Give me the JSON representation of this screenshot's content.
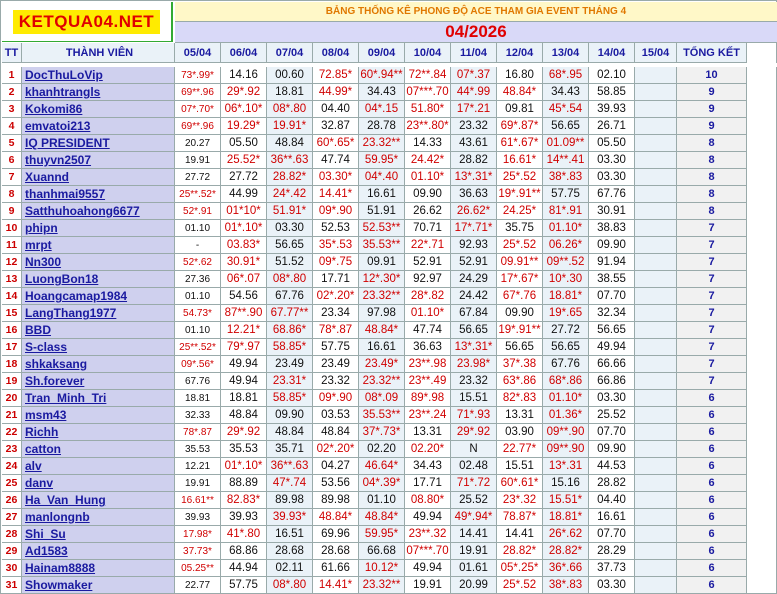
{
  "logo_text": "KETQUA04.NET",
  "title": "BẢNG THỐNG KÊ PHONG ĐỘ ACE THAM GIA EVENT THÁNG 4",
  "month": "04/2026",
  "headers": {
    "tt": "TT",
    "member": "THÀNH VIÊN",
    "dates": [
      "05/04",
      "06/04",
      "07/04",
      "08/04",
      "09/04",
      "10/04",
      "11/04",
      "12/04",
      "13/04",
      "14/04",
      "15/04"
    ],
    "total": "TỔNG KẾT"
  },
  "rows": [
    {
      "tt": "1",
      "name": "DocThuLoVip",
      "cells": [
        "73*.99*",
        "14.16",
        "00.60",
        "72.85*",
        "60*.94**",
        "72**.84",
        "07*.37",
        "16.80",
        "68*.95",
        "02.10",
        ""
      ],
      "total": "10"
    },
    {
      "tt": "2",
      "name": "khanhtrangls",
      "cells": [
        "69**.96",
        "29*.92",
        "18.81",
        "44.99*",
        "34.43",
        "07***.70",
        "44*.99",
        "48.84*",
        "34.43",
        "58.85",
        ""
      ],
      "total": "9"
    },
    {
      "tt": "3",
      "name": "Kokomi86",
      "cells": [
        "07*.70*",
        "06*.10*",
        "08*.80",
        "04.40",
        "04*.15",
        "51.80*",
        "17*.21",
        "09.81",
        "45*.54",
        "39.93",
        ""
      ],
      "total": "9"
    },
    {
      "tt": "4",
      "name": "emvatoi213",
      "cells": [
        "69**.96",
        "19.29*",
        "19.91*",
        "32.87",
        "28.78",
        "23**.80*",
        "23.32",
        "69*.87*",
        "56.65",
        "26.71",
        ""
      ],
      "total": "9"
    },
    {
      "tt": "5",
      "name": "IQ PRESIDENT",
      "cells": [
        "20.27",
        "05.50",
        "48.84",
        "60*.65*",
        "23.32**",
        "14.33",
        "43.61",
        "61*.67*",
        "01.09**",
        "05.50",
        ""
      ],
      "total": "8"
    },
    {
      "tt": "6",
      "name": "thuyvn2507",
      "cells": [
        "19.91",
        "25.52*",
        "36**.63",
        "47.74",
        "59.95*",
        "24.42*",
        "28.82",
        "16.61*",
        "14**.41",
        "03.30",
        ""
      ],
      "total": "8"
    },
    {
      "tt": "7",
      "name": "Xuannd",
      "cells": [
        "27.72",
        "27.72",
        "28.82*",
        "03.30*",
        "04*.40",
        "01.10*",
        "13*.31*",
        "25*.52",
        "38*.83",
        "03.30",
        ""
      ],
      "total": "8"
    },
    {
      "tt": "8",
      "name": "thanhmai9557",
      "cells": [
        "25**.52*",
        "44.99",
        "24*.42",
        "14.41*",
        "16.61",
        "09.90",
        "36.63",
        "19*.91**",
        "57.75",
        "67.76",
        ""
      ],
      "total": "8"
    },
    {
      "tt": "9",
      "name": "Satthuhoahong6677",
      "cells": [
        "52*.91",
        "01*10*",
        "51.91*",
        "09*.90",
        "51.91",
        "26.62",
        "26.62*",
        "24.25*",
        "81*.91",
        "30.91",
        ""
      ],
      "total": "8"
    },
    {
      "tt": "10",
      "name": "phipn",
      "cells": [
        "01.10",
        "01*.10*",
        "03.30",
        "52.53",
        "52.53**",
        "70.71",
        "17*.71*",
        "35.75",
        "01.10*",
        "38.83",
        ""
      ],
      "total": "7"
    },
    {
      "tt": "11",
      "name": "mrpt",
      "cells": [
        "-",
        "03.83*",
        "56.65",
        "35*.53",
        "35.53**",
        "22*.71",
        "92.93",
        "25*.52",
        "06.26*",
        "09.90",
        ""
      ],
      "total": "7"
    },
    {
      "tt": "12",
      "name": "Nn300",
      "cells": [
        "52*.62",
        "30.91*",
        "51.52",
        "09*.75",
        "09.91",
        "52.91",
        "52.91",
        "09.91**",
        "09**.52",
        "91.94",
        ""
      ],
      "total": "7"
    },
    {
      "tt": "13",
      "name": "LuongBon18",
      "cells": [
        "27.36",
        "06*.07",
        "08*.80",
        "17.71",
        "12*.30*",
        "92.97",
        "24.29",
        "17*.67*",
        "10*.30",
        "38.55",
        ""
      ],
      "total": "7"
    },
    {
      "tt": "14",
      "name": "Hoangcamap1984",
      "cells": [
        "01.10",
        "54.56",
        "67.76",
        "02*.20*",
        "23.32**",
        "28*.82",
        "24.42",
        "67*.76",
        "18.81*",
        "07.70",
        ""
      ],
      "total": "7"
    },
    {
      "tt": "15",
      "name": "LangThang1977",
      "cells": [
        "54.73*",
        "87**.90",
        "67.77**",
        "23.34",
        "97.98",
        "01.10*",
        "67.84",
        "09.90",
        "19*.65",
        "32.34",
        ""
      ],
      "total": "7"
    },
    {
      "tt": "16",
      "name": "BBD",
      "cells": [
        "01.10",
        "12.21*",
        "68.86*",
        "78*.87",
        "48.84*",
        "47.74",
        "56.65",
        "19*.91**",
        "27.72",
        "56.65",
        ""
      ],
      "total": "7"
    },
    {
      "tt": "17",
      "name": "S-class",
      "cells": [
        "25**.52*",
        "79*.97",
        "58.85*",
        "57.75",
        "16.61",
        "36.63",
        "13*.31*",
        "56.65",
        "56.65",
        "49.94",
        ""
      ],
      "total": "7"
    },
    {
      "tt": "18",
      "name": "shkaksang",
      "cells": [
        "09*.56*",
        "49.94",
        "23.49",
        "23.49",
        "23.49*",
        "23**.98",
        "23.98*",
        "37*.38",
        "67.76",
        "66.66",
        ""
      ],
      "total": "7"
    },
    {
      "tt": "19",
      "name": "Sh.forever",
      "cells": [
        "67.76",
        "49.94",
        "23.31*",
        "23.32",
        "23.32**",
        "23**.49",
        "23.32",
        "63*.86",
        "68*.86",
        "66.86",
        ""
      ],
      "total": "7"
    },
    {
      "tt": "20",
      "name": "Tran_Minh_Tri",
      "cells": [
        "18.81",
        "18.81",
        "58.85*",
        "09*.90",
        "08*.09",
        "89*.98",
        "15.51",
        "82*.83",
        "01.10*",
        "03.30",
        ""
      ],
      "total": "6"
    },
    {
      "tt": "21",
      "name": "msm43",
      "cells": [
        "32.33",
        "48.84",
        "09.90",
        "03.53",
        "35.53**",
        "23**.24",
        "71*.93",
        "13.31",
        "01.36*",
        "25.52",
        ""
      ],
      "total": "6"
    },
    {
      "tt": "22",
      "name": "Richh",
      "cells": [
        "78*.87",
        "29*.92",
        "48.84",
        "48.84",
        "37*.73*",
        "13.31",
        "29*.92",
        "03.90",
        "09**.90",
        "07.70",
        ""
      ],
      "total": "6"
    },
    {
      "tt": "23",
      "name": "catton",
      "cells": [
        "35.53",
        "35.53",
        "35.71",
        "02*.20*",
        "02.20",
        "02.20*",
        "N",
        "22.77*",
        "09**.90",
        "09.90",
        ""
      ],
      "total": "6"
    },
    {
      "tt": "24",
      "name": "alv",
      "cells": [
        "12.21",
        "01*.10*",
        "36**.63",
        "04.27",
        "46.64*",
        "34.43",
        "02.48",
        "15.51",
        "13*.31",
        "44.53",
        ""
      ],
      "total": "6"
    },
    {
      "tt": "25",
      "name": "danv",
      "cells": [
        "19.91",
        "88.89",
        "47*.74",
        "53.56",
        "04*.39*",
        "17.71",
        "71*.72",
        "60*.61*",
        "15.16",
        "28.82",
        ""
      ],
      "total": "6"
    },
    {
      "tt": "26",
      "name": "Ha_Van_Hung",
      "cells": [
        "16.61**",
        "82.83*",
        "89.98",
        "89.98",
        "01.10",
        "08.80*",
        "25.52",
        "23*.32",
        "15.51*",
        "04.40",
        ""
      ],
      "total": "6"
    },
    {
      "tt": "27",
      "name": "manlongnb",
      "cells": [
        "39.93",
        "39.93",
        "39.93*",
        "48.84*",
        "48.84*",
        "49.94",
        "49*.94*",
        "78.87*",
        "18.81*",
        "16.61",
        ""
      ],
      "total": "6"
    },
    {
      "tt": "28",
      "name": "Shi_Su",
      "cells": [
        "17.98*",
        "41*.80",
        "16.51",
        "69.96",
        "59.95*",
        "23**.32",
        "14.41",
        "14.41",
        "26*.62",
        "07.70",
        ""
      ],
      "total": "6"
    },
    {
      "tt": "29",
      "name": "Ad1583",
      "cells": [
        "37.73*",
        "68.86",
        "28.68",
        "28.68",
        "66.68",
        "07***.70",
        "19.91",
        "28.82*",
        "28.82*",
        "28.29",
        ""
      ],
      "total": "6"
    },
    {
      "tt": "30",
      "name": "Hainam8888",
      "cells": [
        "05.25**",
        "44.94",
        "02.11",
        "61.66",
        "10.12*",
        "49.94",
        "01.61",
        "05*.25*",
        "36*.66",
        "37.73",
        ""
      ],
      "total": "6"
    },
    {
      "tt": "31",
      "name": "Showmaker",
      "cells": [
        "22.77",
        "57.75",
        "08*.80",
        "14.41*",
        "23.32**",
        "19.91",
        "20.99",
        "25*.52",
        "38*.83",
        "03.30",
        ""
      ],
      "total": "6"
    }
  ]
}
